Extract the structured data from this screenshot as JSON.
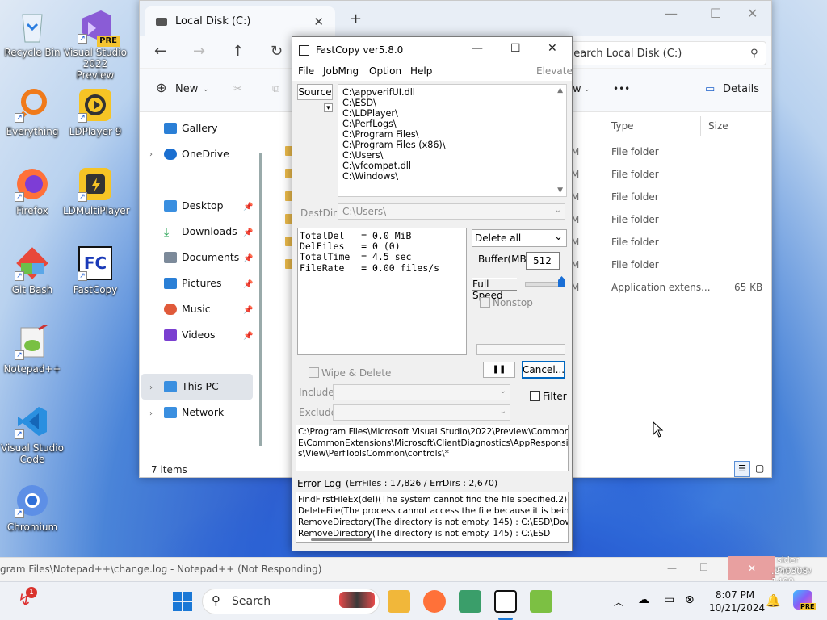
{
  "desktop": {
    "icons": [
      {
        "label": "Recycle Bin"
      },
      {
        "label": "Visual Studio 2022 Preview"
      },
      {
        "label": "Everything"
      },
      {
        "label": "LDPlayer 9"
      },
      {
        "label": "Firefox"
      },
      {
        "label": "LDMultiPlayer"
      },
      {
        "label": "Git Bash"
      },
      {
        "label": "FastCopy"
      },
      {
        "label": "Notepad++"
      },
      {
        "label": "Visual Studio Code"
      },
      {
        "label": "Chromium"
      }
    ],
    "badges": {
      "pre": "PRE",
      "fc": "FC"
    }
  },
  "explorer": {
    "tab_title": "Local Disk (C:)",
    "search_placeholder": "Search Local Disk (C:)",
    "toolbar": {
      "new": "New",
      "details": "Details",
      "more": "•••",
      "view_frag": "w"
    },
    "nav": [
      {
        "label": "Gallery"
      },
      {
        "label": "OneDrive"
      },
      {
        "label": "Desktop"
      },
      {
        "label": "Downloads"
      },
      {
        "label": "Documents"
      },
      {
        "label": "Pictures"
      },
      {
        "label": "Music"
      },
      {
        "label": "Videos"
      },
      {
        "label": "This PC"
      },
      {
        "label": "Network"
      }
    ],
    "columns": {
      "type": "Type",
      "size": "Size"
    },
    "rows": [
      {
        "m": "M",
        "type": "File folder",
        "size": ""
      },
      {
        "m": "M",
        "type": "File folder",
        "size": ""
      },
      {
        "m": "M",
        "type": "File folder",
        "size": ""
      },
      {
        "m": "M",
        "type": "File folder",
        "size": ""
      },
      {
        "m": "M",
        "type": "File folder",
        "size": ""
      },
      {
        "m": "M",
        "type": "File folder",
        "size": ""
      },
      {
        "m": "M",
        "type": "Application extens...",
        "size": "65 KB"
      }
    ],
    "status": "7 items"
  },
  "fastcopy": {
    "title": "FastCopy ver5.8.0",
    "menu": [
      "File",
      "JobMng",
      "Option",
      "Help"
    ],
    "elevate": "Elevate",
    "source_label": "Source",
    "source_list": "C:\\appverifUI.dll\nC:\\ESD\\\nC:\\LDPlayer\\\nC:\\PerfLogs\\\nC:\\Program Files\\\nC:\\Program Files (x86)\\\nC:\\Users\\\nC:\\vfcompat.dll\nC:\\Windows\\",
    "destdir_label": "DestDir",
    "destdir_value": "C:\\Users\\",
    "stats": "TotalDel   = 0.0 MiB\nDelFiles   = 0 (0)\nTotalTime  = 4.5 sec\nFileRate   = 0.00 files/s",
    "mode": "Delete all",
    "buffer_label": "Buffer(MB)",
    "buffer_value": "512",
    "speed_label": "Full Speed",
    "speed_level": 1.0,
    "nonstop_label": "Nonstop",
    "wipe_label": "Wipe & Delete",
    "pause_label": "❚❚",
    "cancel_label": "Cancel...",
    "include_label": "Include",
    "exclude_label": "Exclude",
    "filter_label": "Filter",
    "current_path": "C:\\Program Files\\Microsoft Visual Studio\\2022\\Preview\\Common7\\ID\nE\\CommonExtensions\\Microsoft\\ClientDiagnostics\\AppResponsivenes\ns\\View\\PerfToolsCommon\\controls\\*",
    "errlog_label": "Error Log",
    "errlog_counts": "(ErrFiles : 17,826 / ErrDirs : 2,670)",
    "errlog": "FindFirstFileEx(del)(The system cannot find the file specified.2) : C\nDeleteFile(The process cannot access the file because it is being u\nRemoveDirectory(The directory is not empty. 145) : C:\\ESD\\Downl\nRemoveDirectory(The directory is not empty. 145) : C:\\ESD"
  },
  "notepadpp": {
    "title": "gram Files\\Notepad++\\change.log - Notepad++ (Not Responding)",
    "right_text_1": "sider Preview",
    "right_text_2": ".240308-1400"
  },
  "taskbar": {
    "search": "Search",
    "badge": "1",
    "time": "8:07 PM",
    "date": "10/21/2024",
    "copilot_badge": "PRE"
  }
}
